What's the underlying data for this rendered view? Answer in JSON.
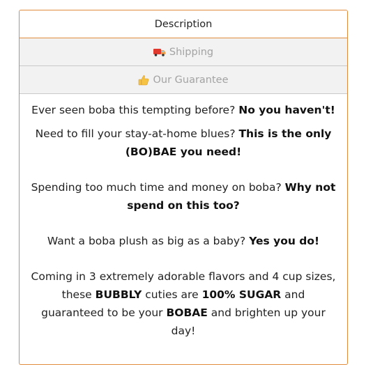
{
  "tabs": {
    "description": {
      "label": "Description"
    },
    "shipping": {
      "label": "Shipping",
      "icon": "delivery-truck-icon"
    },
    "guarantee": {
      "label": "Our Guarantee",
      "icon": "thumbs-up-icon"
    }
  },
  "description": {
    "p1": {
      "text": "Ever seen boba this tempting before? ",
      "bold": "No you haven't!"
    },
    "p2": {
      "text": "Need to fill your stay-at-home blues? ",
      "bold": "This is the only (BO)BAE you need!"
    },
    "p3": {
      "text": "Spending too much time and money on boba? ",
      "bold": "Why not spend on this too?"
    },
    "p4": {
      "text": "Want a boba plush as big as a baby? ",
      "bold": "Yes you do!"
    },
    "p5": {
      "t1": "Coming in 3 extremely adorable flavors and 4 cup sizes, these ",
      "b1": "BUBBLY",
      "t2": " cuties are ",
      "b2": "100% SUGAR",
      "t3": " and guaranteed to be your ",
      "b3": "BOBAE",
      "t4": " and brighten up your day!"
    }
  },
  "colors": {
    "accent_border": "#e08a3c",
    "inactive_tab_bg": "#f2f2f2",
    "inactive_tab_text": "#a3a3a3"
  }
}
